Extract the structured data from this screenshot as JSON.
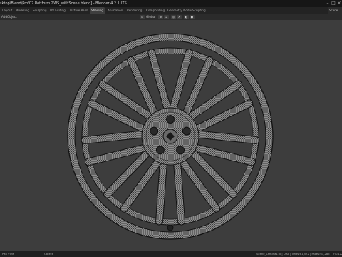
{
  "window": {
    "title": "sktop\\Blend\\Pro\\07.Rotiform ZWS_withScene.blend] - Blender 4.2.1 LTS",
    "controls": [
      "–",
      "□",
      "×"
    ]
  },
  "workspace_tabs": [
    {
      "label": "Layout",
      "active": false
    },
    {
      "label": "Modeling",
      "active": false
    },
    {
      "label": "Sculpting",
      "active": false
    },
    {
      "label": "UV Editing",
      "active": false
    },
    {
      "label": "Texture Paint",
      "active": false
    },
    {
      "label": "Shading",
      "active": true
    },
    {
      "label": "Animation",
      "active": false
    },
    {
      "label": "Rendering",
      "active": false
    },
    {
      "label": "Compositing",
      "active": false
    },
    {
      "label": "Geometry Nodes",
      "active": false
    },
    {
      "label": "Scripting",
      "active": false
    }
  ],
  "header": {
    "menu_items": [
      "Add",
      "Object"
    ],
    "transform_orientation": "Global",
    "scene_label": "Scene"
  },
  "statusbar": {
    "left": "Pan View",
    "middle": "Object",
    "right": "Scene_Laminas.fx | Disc | Verts:61,572 | Faces:61,285 | Tris:122"
  },
  "viewport": {
    "background_color": "#3d3d3d",
    "wire_color": "#000000",
    "surface_color": "#8c8c8c",
    "object": "wheel-rim"
  }
}
